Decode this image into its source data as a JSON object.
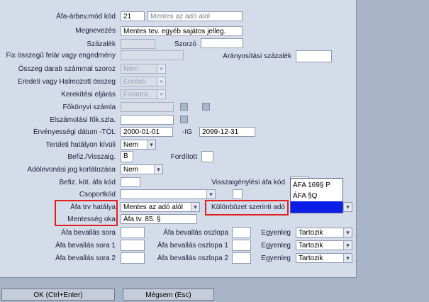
{
  "form": {
    "afa_arbev_mod_kod": {
      "label": "Áfa-árbev.mód kód",
      "code": "21",
      "desc": "Mentes az adó alól"
    },
    "megnevezes": {
      "label": "Megnevezés",
      "value": "Mentes tev. egyéb sajátos jelleg."
    },
    "szazalek": {
      "label": "Százalék",
      "value": ""
    },
    "szorzo": {
      "label": "Szorzó",
      "value": ""
    },
    "fix_osszegu": {
      "label": "Fix összegű felár vagy engedmény",
      "value": ""
    },
    "aranyositasi": {
      "label": "Arányosítási százalék",
      "value": ""
    },
    "osszeg_darab": {
      "label": "Összeg darab számmal szoroz",
      "value": "Nem"
    },
    "eredeti_halmozott": {
      "label": "Eredeti vagy Halmozott összeg",
      "value": "Eredeti"
    },
    "kerekitesi": {
      "label": "Kerekítési eljárás",
      "value": "Forintra"
    },
    "fokonyvi": {
      "label": "Főkönyvi számla",
      "value": ""
    },
    "elszamolasi": {
      "label": "Elszámolási fők.szla.",
      "value": ""
    },
    "ervenyessegi_tol": {
      "label": "Érvényességi dátum -TÓL",
      "value": "2000-01-01"
    },
    "ervenyessegi_ig": {
      "label": "-IG",
      "value": "2099-12-31"
    },
    "teruleti": {
      "label": "Területi hatályon kívüli",
      "value": "Nem"
    },
    "befiz_visszaig": {
      "label": "Befiz./Visszaig.",
      "value": "B"
    },
    "forditott": {
      "label": "Fordított",
      "value": ""
    },
    "adolevonasi": {
      "label": "Adólevonási jog korlátozása",
      "value": "Nem"
    },
    "befiz_kot": {
      "label": "Befiz. köt. áfa kód",
      "value": ""
    },
    "visszaigenylesi": {
      "label": "Visszaigénylési áfa kód",
      "value": ""
    },
    "csoportkod": {
      "label": "Csoportkód",
      "value": ""
    },
    "afa_trv_hatalya": {
      "label": "Áfa trv hatálya",
      "value": "Mentes az adó alól"
    },
    "kulonbozet": {
      "label": "Különbözet szerinti adó",
      "value": ""
    },
    "mentesseg_oka": {
      "label": "Mentesség oka",
      "value": "Áfa tv. 85. §"
    },
    "bevallas_sora": {
      "label": "Áfa bevallás sora",
      "value": ""
    },
    "bevallas_oszlopa": {
      "label": "Áfa bevallás oszlopa",
      "value": ""
    },
    "egyenleg1": {
      "label": "Egyenleg",
      "value": "Tartozik"
    },
    "bevallas_sora1": {
      "label": "Áfa bevallás sora 1",
      "value": ""
    },
    "bevallas_oszlopa1": {
      "label": "Áfa bevallás oszlopa 1",
      "value": ""
    },
    "egyenleg2": {
      "label": "Egyenleg",
      "value": "Tartozik"
    },
    "bevallas_sora2": {
      "label": "Áfa bevallás sora 2",
      "value": ""
    },
    "bevallas_oszlopa2": {
      "label": "Áfa bevallás oszlopa 2",
      "value": ""
    },
    "egyenleg3": {
      "label": "Egyenleg",
      "value": "Tartozik"
    }
  },
  "dropdown": {
    "options": [
      "ÁFA 169§ P",
      "ÁFA §Q",
      ""
    ]
  },
  "buttons": {
    "ok": "OK (Ctrl+Enter)",
    "cancel": "Mégsem (Esc)"
  },
  "colors": {
    "highlight": "#0a1ee8",
    "annotation_red": "#e02020"
  }
}
